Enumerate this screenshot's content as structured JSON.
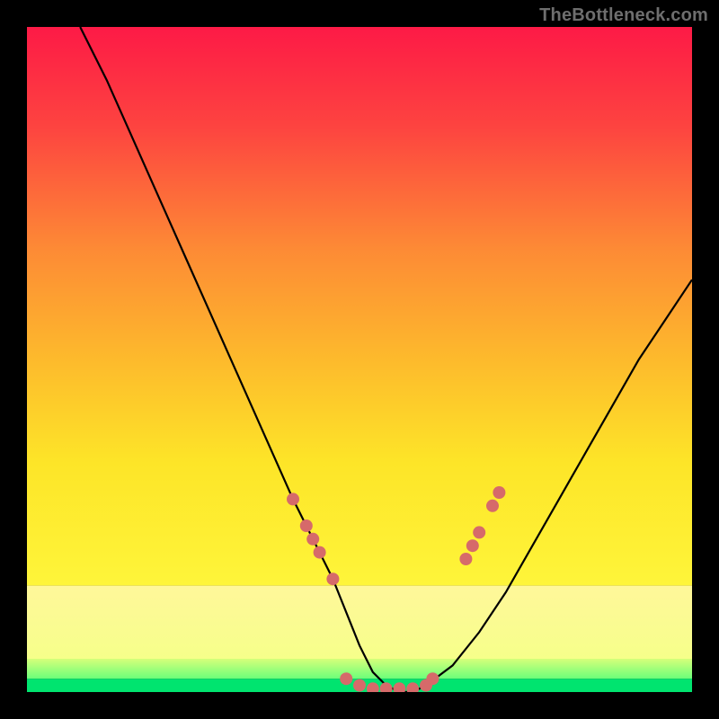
{
  "watermark": "TheBottleneck.com",
  "chart_data": {
    "type": "line",
    "title": "",
    "xlabel": "",
    "ylabel": "",
    "xlim": [
      0,
      100
    ],
    "ylim": [
      0,
      100
    ],
    "grid": false,
    "legend": false,
    "series": [
      {
        "name": "bottleneck-curve",
        "x": [
          8,
          12,
          16,
          20,
          24,
          28,
          32,
          36,
          40,
          42,
          44,
          46,
          48,
          50,
          52,
          54,
          56,
          58,
          60,
          64,
          68,
          72,
          76,
          80,
          84,
          88,
          92,
          96,
          100
        ],
        "y": [
          100,
          92,
          83,
          74,
          65,
          56,
          47,
          38,
          29,
          25,
          21,
          17,
          12,
          7,
          3,
          1,
          0,
          0,
          1,
          4,
          9,
          15,
          22,
          29,
          36,
          43,
          50,
          56,
          62
        ]
      }
    ],
    "markers": {
      "name": "highlight-dots",
      "color": "#d66a6a",
      "points": [
        {
          "x": 40,
          "y": 29
        },
        {
          "x": 42,
          "y": 25
        },
        {
          "x": 43,
          "y": 23
        },
        {
          "x": 44,
          "y": 21
        },
        {
          "x": 46,
          "y": 17
        },
        {
          "x": 48,
          "y": 2
        },
        {
          "x": 50,
          "y": 1
        },
        {
          "x": 52,
          "y": 0.5
        },
        {
          "x": 54,
          "y": 0.5
        },
        {
          "x": 56,
          "y": 0.5
        },
        {
          "x": 58,
          "y": 0.5
        },
        {
          "x": 60,
          "y": 1
        },
        {
          "x": 61,
          "y": 2
        },
        {
          "x": 66,
          "y": 20
        },
        {
          "x": 67,
          "y": 22
        },
        {
          "x": 68,
          "y": 24
        },
        {
          "x": 70,
          "y": 28
        },
        {
          "x": 71,
          "y": 30
        }
      ]
    },
    "bands": [
      {
        "name": "green-band",
        "y0": 0,
        "y1": 2,
        "color_top": "#00e46f",
        "color_bottom": "#00e46f"
      },
      {
        "name": "light-green-band",
        "y0": 2,
        "y1": 5,
        "color_top": "#d6ff7a",
        "color_bottom": "#6bff7a"
      },
      {
        "name": "cream-band",
        "y0": 5,
        "y1": 16,
        "color_top": "#fff79a",
        "color_bottom": "#f6ff8a"
      }
    ],
    "gradient_stops": [
      {
        "offset": 0,
        "color": "#fd1a46"
      },
      {
        "offset": 18,
        "color": "#fd4440"
      },
      {
        "offset": 40,
        "color": "#fd8b35"
      },
      {
        "offset": 60,
        "color": "#fdbb2c"
      },
      {
        "offset": 78,
        "color": "#fde528"
      },
      {
        "offset": 100,
        "color": "#fef53a"
      }
    ]
  }
}
